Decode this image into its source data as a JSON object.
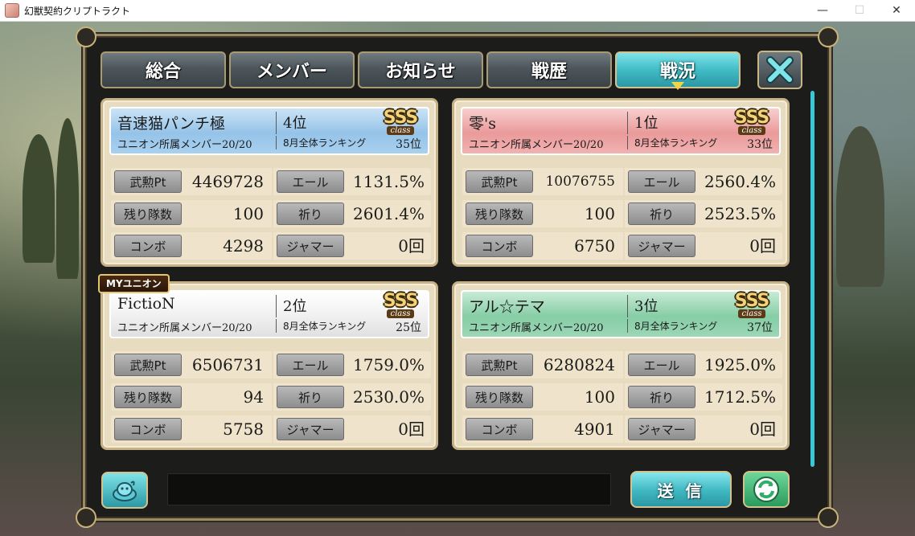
{
  "window": {
    "title": "幻獣契約クリプトラクト",
    "minimize": "—",
    "maximize": "☐",
    "close": "✕"
  },
  "tabs": [
    {
      "label": "総合",
      "active": false
    },
    {
      "label": "メンバー",
      "active": false
    },
    {
      "label": "お知らせ",
      "active": false
    },
    {
      "label": "戦歴",
      "active": false
    },
    {
      "label": "戦況",
      "active": true
    }
  ],
  "labels": {
    "members": "ユニオン所属メンバー20/20",
    "monthly": "8月全体ランキング",
    "stat_pt": "武勲Pt",
    "stat_ale": "エール",
    "stat_remain": "残り隊数",
    "stat_pray": "祈り",
    "stat_combo": "コンボ",
    "stat_jammer": "ジャマー",
    "sss": "SSS",
    "sss_class": "class",
    "my_union": "MYユニオン"
  },
  "unions": [
    {
      "name": "音速猫パンチ極",
      "rank": "4位",
      "monthly_rank": "35位",
      "color": "blue",
      "pt": "4469728",
      "ale": "1131.5%",
      "remain": "100",
      "pray": "2601.4%",
      "combo": "4298",
      "jammer": "0回"
    },
    {
      "name": "零's",
      "rank": "1位",
      "monthly_rank": "33位",
      "color": "pink",
      "pt": "10076755",
      "ale": "2560.4%",
      "remain": "100",
      "pray": "2523.5%",
      "combo": "6750",
      "jammer": "0回"
    },
    {
      "name": "FictioN",
      "rank": "2位",
      "monthly_rank": "25位",
      "color": "white",
      "pt": "6506731",
      "ale": "1759.0%",
      "remain": "94",
      "pray": "2530.0%",
      "combo": "5758",
      "jammer": "0回"
    },
    {
      "name": "アル☆テマ",
      "rank": "3位",
      "monthly_rank": "37位",
      "color": "green",
      "pt": "6280824",
      "ale": "1925.0%",
      "remain": "100",
      "pray": "1712.5%",
      "combo": "4901",
      "jammer": "0回"
    }
  ],
  "bottom": {
    "chat_value": "",
    "send_label": "送 信"
  },
  "icons": {
    "close_tab": "close-icon",
    "stamp": "stamp-icon",
    "refresh": "refresh-icon"
  }
}
